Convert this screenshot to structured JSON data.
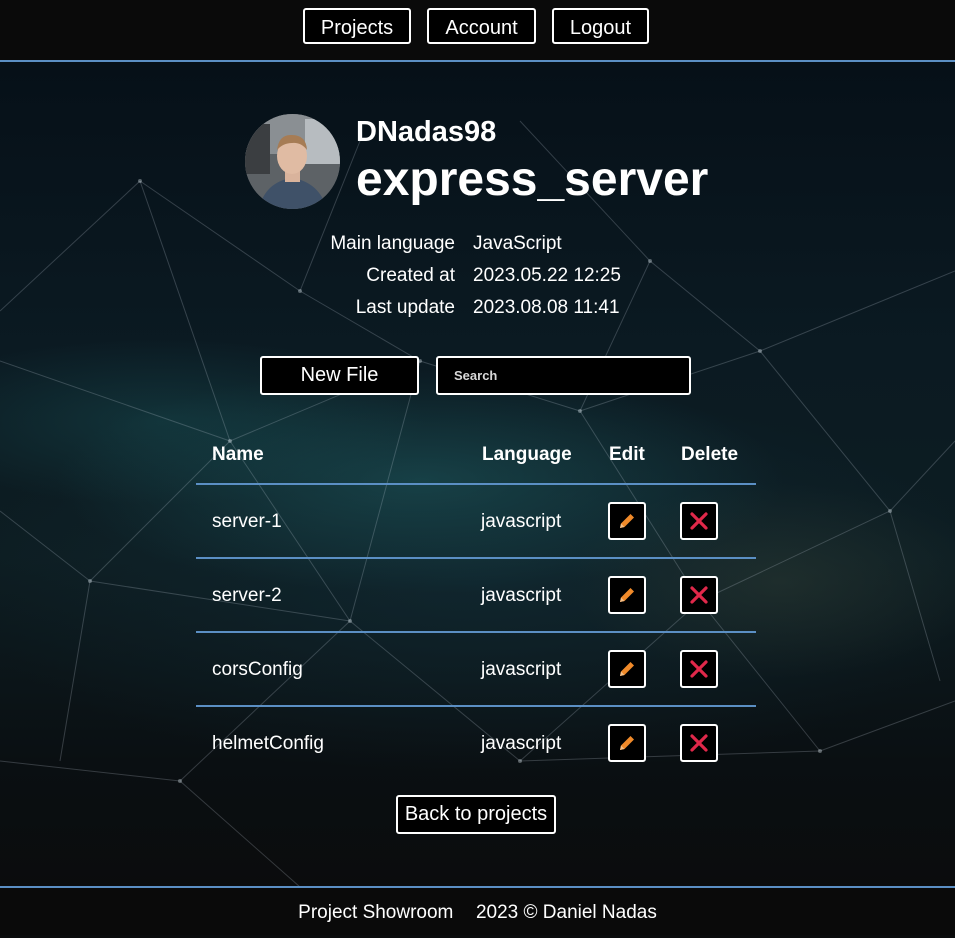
{
  "nav": {
    "items": [
      {
        "label": "Projects"
      },
      {
        "label": "Account"
      },
      {
        "label": "Logout"
      }
    ]
  },
  "profile": {
    "username": "DNadas98",
    "project_name": "express_server"
  },
  "meta": {
    "main_language_label": "Main language",
    "main_language_value": "JavaScript",
    "created_label": "Created at",
    "created_value": "2023.05.22 12:25",
    "updated_label": "Last update",
    "updated_value": "2023.08.08 11:41"
  },
  "actions": {
    "new_file_label": "New File",
    "search_placeholder": "Search"
  },
  "table": {
    "headers": {
      "name": "Name",
      "language": "Language",
      "edit": "Edit",
      "delete": "Delete"
    },
    "rows": [
      {
        "name": "server-1",
        "language": "javascript"
      },
      {
        "name": "server-2",
        "language": "javascript"
      },
      {
        "name": "corsConfig",
        "language": "javascript"
      },
      {
        "name": "helmetConfig",
        "language": "javascript"
      }
    ]
  },
  "back_label": "Back to projects",
  "footer": {
    "brand": "Project Showroom",
    "copyright": "2023 © Daniel Nadas"
  },
  "icons": {
    "edit": "pencil-icon",
    "delete": "close-icon"
  },
  "colors": {
    "accent_line": "#5b8fc4",
    "pencil": "#f08a2a",
    "delete_x": "#e0284a"
  }
}
